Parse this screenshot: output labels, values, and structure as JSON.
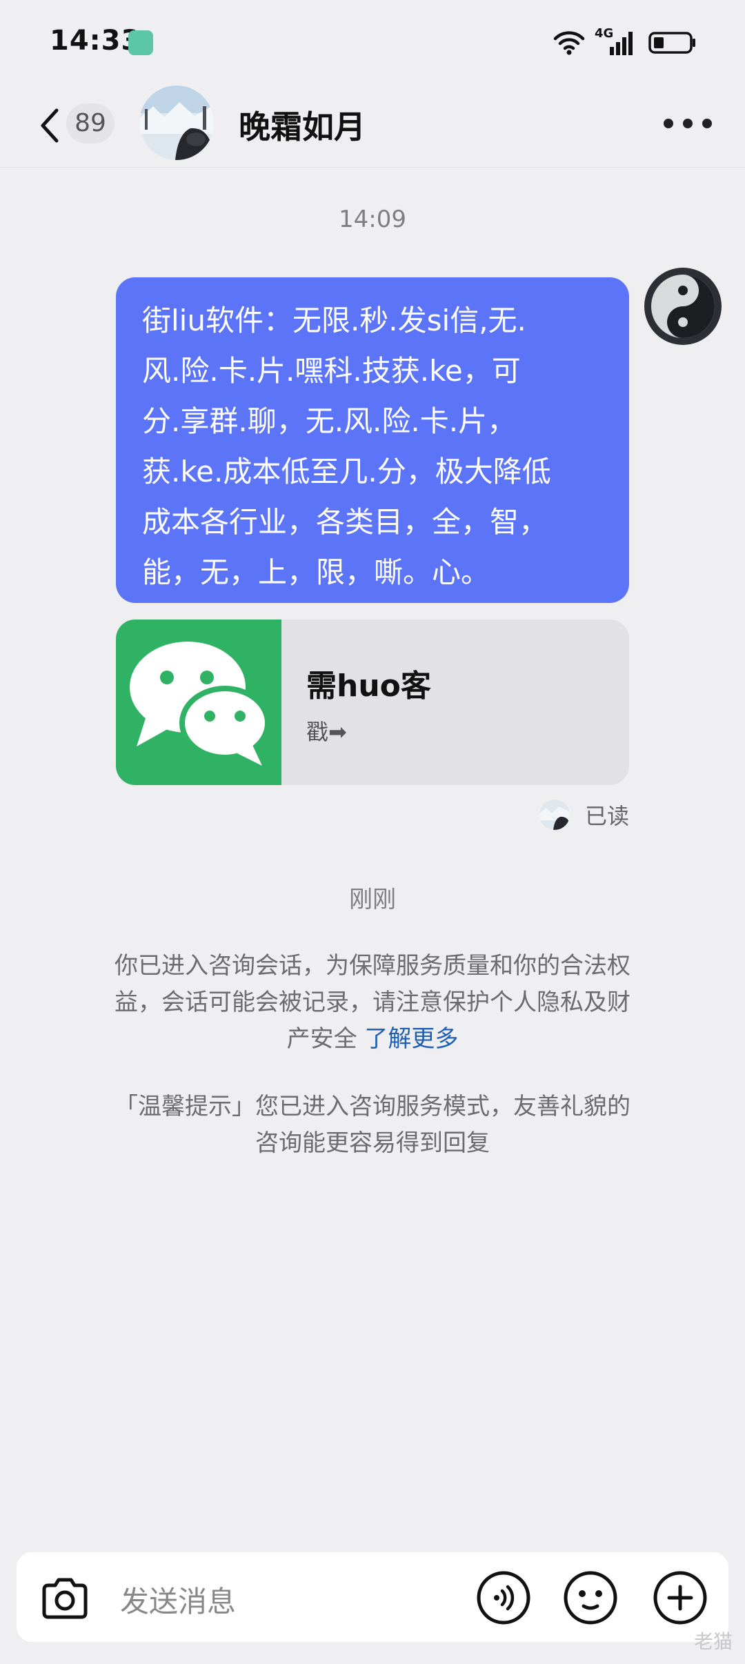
{
  "status_bar": {
    "time": "14:33",
    "network": "4G"
  },
  "header": {
    "unread_count": "89",
    "contact_name": "晚霜如月"
  },
  "chat": {
    "timestamp_1": "14:09",
    "message_lines": [
      "街liu软件：无限.秒.发si信,无.",
      "风.险.卡.片.嘿科.技获.ke，可",
      "分.享群.聊，无.风.险.卡.片，",
      "获.ke.成本低至几.分，极大降低",
      "成本各行业，各类目，全，智，",
      "能，无，上，限，嘶。心。"
    ],
    "card_title": "需huo客",
    "card_subtitle": "戳➡",
    "read_status": "已读",
    "timestamp_2": "刚刚",
    "notice_1_lines": [
      "你已进入咨询会话，为保障服务质量和你的合法权",
      "益，会话可能会被记录，请注意保护个人隐私及财"
    ],
    "notice_1_tail": "产安全",
    "notice_1_link": "了解更多",
    "notice_2_lines": [
      "「温馨提示」您已进入咨询服务模式，友善礼貌的",
      "咨询能更容易得到回复"
    ]
  },
  "input_bar": {
    "placeholder": "发送消息"
  },
  "watermark": "老猫",
  "colors": {
    "bubble": "#5c74f7",
    "card_thumb": "#2fb263",
    "link": "#1f5fb3",
    "background": "#efeff1"
  }
}
